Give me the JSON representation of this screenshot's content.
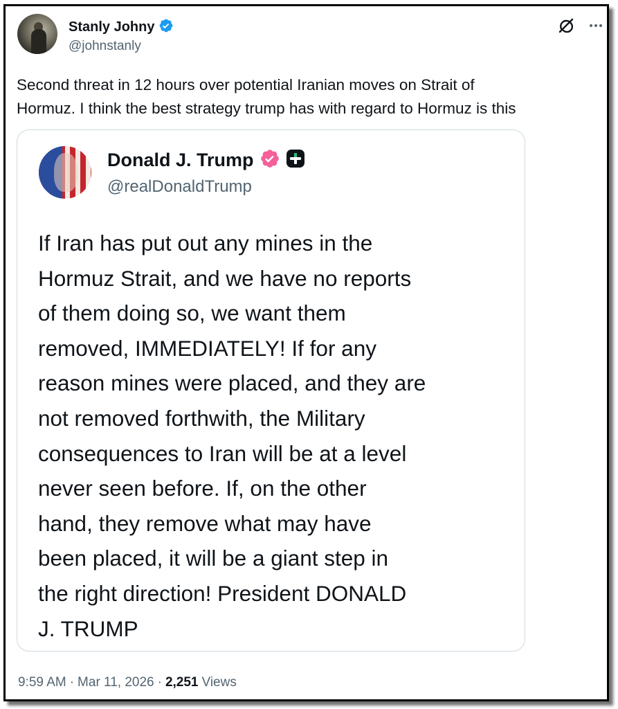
{
  "author": {
    "display_name": "Stanly Johny",
    "handle": "@johnstanly",
    "verified": true
  },
  "header_icons": [
    "grok-icon",
    "more-icon"
  ],
  "tweet": {
    "text": "Second threat in 12 hours over potential Iranian moves on Strait of\nHormuz. I think the best strategy trump has with regard to Hormuz is this"
  },
  "quoted": {
    "display_name": "Donald J. Trump",
    "handle": "@realDonaldTrump",
    "text": "If Iran has put out any mines in the\nHormuz Strait, and we have no reports\nof them doing so, we want them\nremoved, IMMEDIATELY! If for any\nreason mines were placed, and they are\nnot removed forthwith, the Military\nconsequences to Iran will be at a level\nnever seen before. If, on the other\nhand, they remove what may have\nbeen placed, it will be a giant step in\nthe right direction! President DONALD\nJ. TRUMP"
  },
  "footer": {
    "time": "9:59 AM",
    "sep1": "·",
    "date": "Mar 11, 2026",
    "sep2": "·",
    "views_count": "2,251",
    "views_label": "Views"
  },
  "colors": {
    "verified_blue": "#1d9bf0",
    "verified_pink": "#f5609b",
    "secondary_text": "#536471",
    "border": "#cfd9de"
  }
}
